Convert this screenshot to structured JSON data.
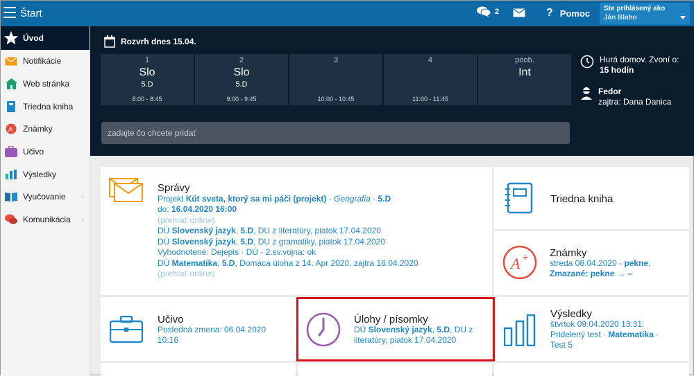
{
  "topbar": {
    "title": "Štart",
    "chat_count": "2",
    "help_label": "Pomoc",
    "user_label": "Ste prihlásený ako",
    "user_name": "Ján Blaho"
  },
  "sidebar": {
    "items": [
      {
        "label": "Úvod",
        "icon": "star-icon"
      },
      {
        "label": "Notifikácie",
        "icon": "envelope-icon"
      },
      {
        "label": "Web stránka",
        "icon": "home-icon"
      },
      {
        "label": "Triedna kniha",
        "icon": "book-icon"
      },
      {
        "label": "Známky",
        "icon": "grade-icon"
      },
      {
        "label": "Učivo",
        "icon": "briefcase-icon"
      },
      {
        "label": "Výsledky",
        "icon": "bar-chart-icon"
      },
      {
        "label": "Vyučovanie",
        "icon": "open-book-icon"
      },
      {
        "label": "Komunikácia",
        "icon": "chat-icon"
      }
    ]
  },
  "schedule": {
    "title": "Rozvrh dnes 15.04.",
    "slots": [
      {
        "num": "1",
        "subject": "Slo",
        "class": "5.D",
        "time": "8:00 - 8:45"
      },
      {
        "num": "2",
        "subject": "Slo",
        "class": "5.D",
        "time": "9:00 - 9:45"
      },
      {
        "num": "3",
        "subject": "",
        "class": "",
        "time": "10:00 - 10:45"
      },
      {
        "num": "4",
        "subject": "",
        "class": "",
        "time": "11:00 - 11:45"
      },
      {
        "num": "poob.",
        "subject": "Int",
        "class": "",
        "time": ""
      }
    ],
    "add_placeholder": "zadajte čo chcete pridať",
    "home_text": "Hurá domov. Zvoní o:",
    "home_value": "15 hodín",
    "person_name": "Fedor",
    "person_text": "zajtra: Dana Danica"
  },
  "spravy": {
    "title": "Správy",
    "l1_prefix": "Projekt ",
    "l1_bold": "Kút sveta, ktorý sa mi páči (projekt)",
    "l1_sep": " · ",
    "l1_subject": "Geografia",
    "l1_sep2": " · ",
    "l1_class": "5.D",
    "l2_prefix": "do: ",
    "l2_bold": "16.04.2020 16:00",
    "l3": "(prehrať online)",
    "l4_prefix": "DÚ ",
    "l4_bold": "Slovenský jazyk",
    "l4_sep": ", ",
    "l4_class": "5.D",
    "l4_rest": ", DU z literatúry, piatok 17.04.2020",
    "l5_prefix": "DÚ ",
    "l5_bold": "Slovenský jazyk",
    "l5_sep": ", ",
    "l5_class": "5.D",
    "l5_rest": ", DU z gramatiky, piatok 17.04.2020",
    "l6": "Vyhodnotené: Dejepis · DÚ - 2.sv.vojna: ok",
    "l7_prefix": "DÚ ",
    "l7_bold": "Matematika",
    "l7_sep": ", ",
    "l7_class": "5.D",
    "l7_rest": ", Domáca úloha z 14. Apr 2020, zajtra 16.04.2020",
    "l8": "(prehrať online)"
  },
  "kniha": {
    "title": "Triedna kniha"
  },
  "znamky": {
    "title": "Známky",
    "l1": "streda 08.04.2020 - ",
    "l1_bold": "pekne",
    "l1_end": ",",
    "l2_bold": "Zmazané: pekne → –"
  },
  "ucivo": {
    "title": "Učivo",
    "l1": "Posledná zmena: 06.04.2020",
    "l2": "10:16"
  },
  "ulohy": {
    "title": "Úlohy / písomky",
    "l1_prefix": "DÚ ",
    "l1_bold": "Slovenský jazyk",
    "l1_sep": ", ",
    "l1_class": "5.D",
    "l1_rest": ", DU z",
    "l2": "literatúry, piatok 17.04.2020"
  },
  "vysledky": {
    "title": "Výsledky",
    "l1": "štvrtok 09.04.2020 13:31:",
    "l2": "Pridelený test · ",
    "l2_bold": "Matematika",
    "l2_end": " ·",
    "l3": "Test 5"
  },
  "colors": {
    "topbar": "#0e6aa6",
    "dark_panel": "#0a1c2c",
    "link": "#1f86c8",
    "highlight": "#d7141c",
    "orange": "#f39c12"
  }
}
